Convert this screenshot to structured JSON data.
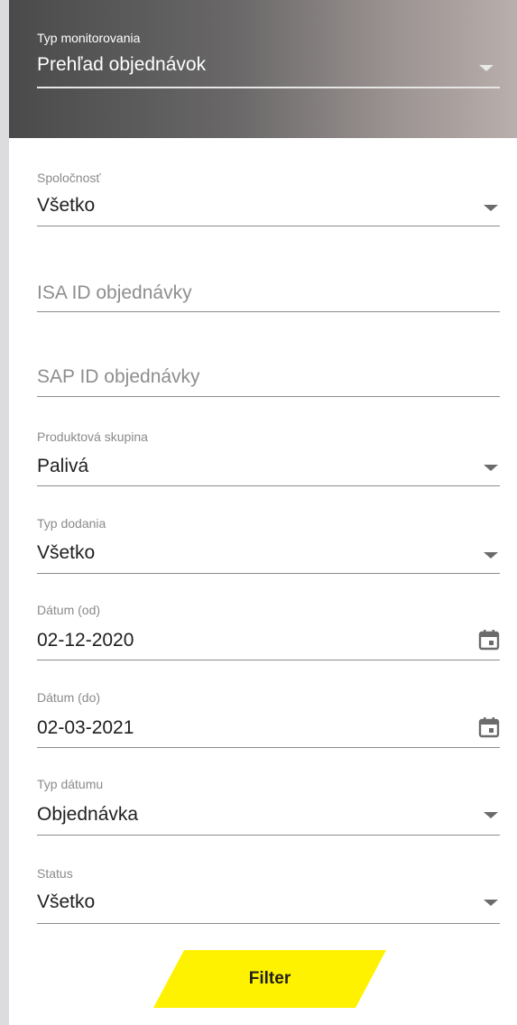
{
  "header": {
    "label": "Typ monitorovania",
    "value": "Prehľad objednávok"
  },
  "fields": {
    "company": {
      "label": "Spoločnosť",
      "value": "Všetko"
    },
    "isa_id": {
      "placeholder": "ISA ID objednávky"
    },
    "sap_id": {
      "placeholder": "SAP ID objednávky"
    },
    "product_group": {
      "label": "Produktová skupina",
      "value": "Palivá"
    },
    "delivery_type": {
      "label": "Typ dodania",
      "value": "Všetko"
    },
    "date_from": {
      "label": "Dátum (od)",
      "value": "02-12-2020"
    },
    "date_to": {
      "label": "Dátum (do)",
      "value": "02-03-2021"
    },
    "date_type": {
      "label": "Typ dátumu",
      "value": "Objednávka"
    },
    "status": {
      "label": "Status",
      "value": "Všetko"
    }
  },
  "filter_button": {
    "label": "Filter"
  },
  "colors": {
    "header_dark": "#4a4a4b",
    "header_light": "#b9afac",
    "accent_yellow": "#fff200"
  },
  "icons": [
    "chevron-down-icon",
    "calendar-icon"
  ]
}
